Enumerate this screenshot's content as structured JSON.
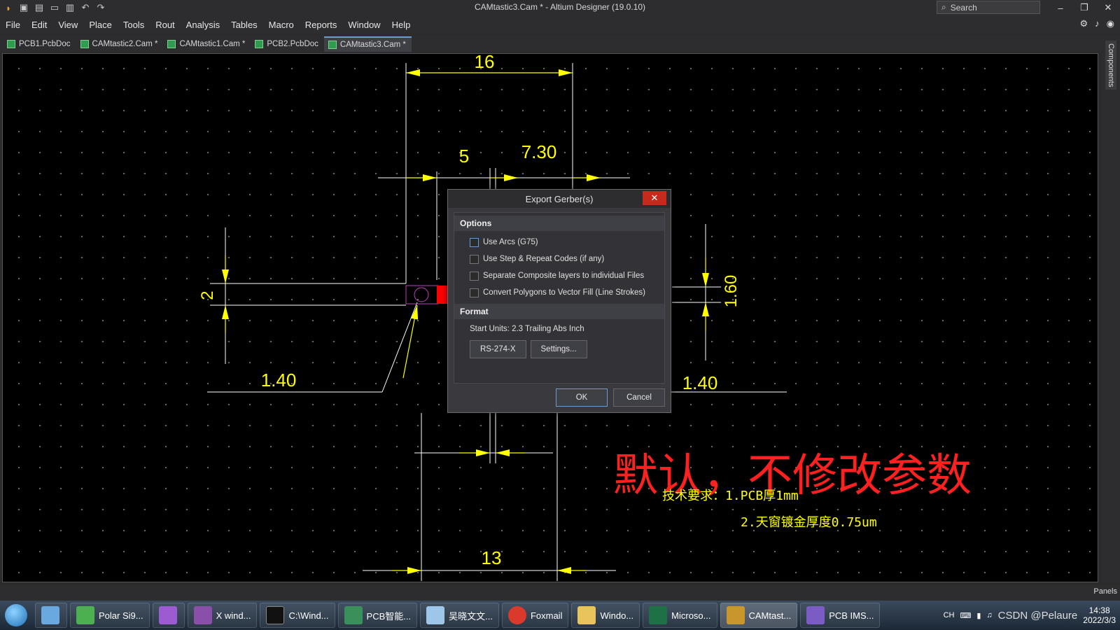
{
  "window": {
    "title": "CAMtastic3.Cam * - Altium Designer (19.0.10)",
    "search_placeholder": "Search",
    "controls": [
      "–",
      "❐",
      "✕"
    ]
  },
  "menu": [
    "File",
    "Edit",
    "View",
    "Place",
    "Tools",
    "Rout",
    "Analysis",
    "Tables",
    "Macro",
    "Reports",
    "Window",
    "Help"
  ],
  "tabs": [
    {
      "label": "PCB1.PcbDoc",
      "active": false
    },
    {
      "label": "CAMtastic2.Cam *",
      "active": false
    },
    {
      "label": "CAMtastic1.Cam *",
      "active": false
    },
    {
      "label": "PCB2.PcbDoc",
      "active": false
    },
    {
      "label": "CAMtastic3.Cam *",
      "active": true
    }
  ],
  "side_panel": {
    "components_label": "Components"
  },
  "status": {
    "panels_label": "Panels"
  },
  "drawing": {
    "dims": {
      "d16": "16",
      "d5": "5",
      "d730": "7.30",
      "d2": "2",
      "d160": "1.60",
      "d140a": "1.40",
      "d140b": "1.40",
      "d13": "13"
    },
    "colors": {
      "dimension": "#ffff00",
      "lines": "#ffffff",
      "note_red": "#ff2020",
      "pad": "#ff0000"
    }
  },
  "notes": {
    "big": "默认，不修改参数",
    "line1": "技术要求：1.PCB厚1mm",
    "line2": "2.天窗镀金厚度0.75um"
  },
  "dialog": {
    "title": "Export Gerber(s)",
    "close": "✕",
    "options_header": "Options",
    "options": [
      {
        "label": "Use Arcs (G75)",
        "checked": false
      },
      {
        "label": "Use Step & Repeat Codes (if any)",
        "checked": false
      },
      {
        "label": "Separate Composite layers to individual Files",
        "checked": false
      },
      {
        "label": "Convert Polygons to Vector Fill (Line Strokes)",
        "checked": false
      }
    ],
    "format_header": "Format",
    "start_units": "Start Units: 2.3 Trailing Abs Inch",
    "format_button": "RS-274-X",
    "settings_button": "Settings...",
    "ok": "OK",
    "cancel": "Cancel"
  },
  "taskbar": {
    "items": [
      {
        "label": "",
        "icon": "desktop-icon"
      },
      {
        "label": "Polar Si9...",
        "icon": "polar-icon"
      },
      {
        "label": "",
        "icon": "pcb-tool-icon"
      },
      {
        "label": "X wind...",
        "icon": "xwin-icon"
      },
      {
        "label": "C:\\Wind...",
        "icon": "cmd-icon"
      },
      {
        "label": "PCB智能...",
        "icon": "pcb-smart-icon"
      },
      {
        "label": "吴晓文文...",
        "icon": "doc-icon"
      },
      {
        "label": "Foxmail",
        "icon": "foxmail-icon"
      },
      {
        "label": "Windo...",
        "icon": "folder-icon"
      },
      {
        "label": "Microso...",
        "icon": "excel-icon"
      },
      {
        "label": "CAMtast...",
        "icon": "altium-icon"
      },
      {
        "label": "PCB IMS...",
        "icon": "pcb-ims-icon"
      }
    ],
    "tray_lang": "CH",
    "clock_time": "14:38",
    "clock_date": "2022/3/3",
    "watermark": "CSDN @Pelaure"
  }
}
